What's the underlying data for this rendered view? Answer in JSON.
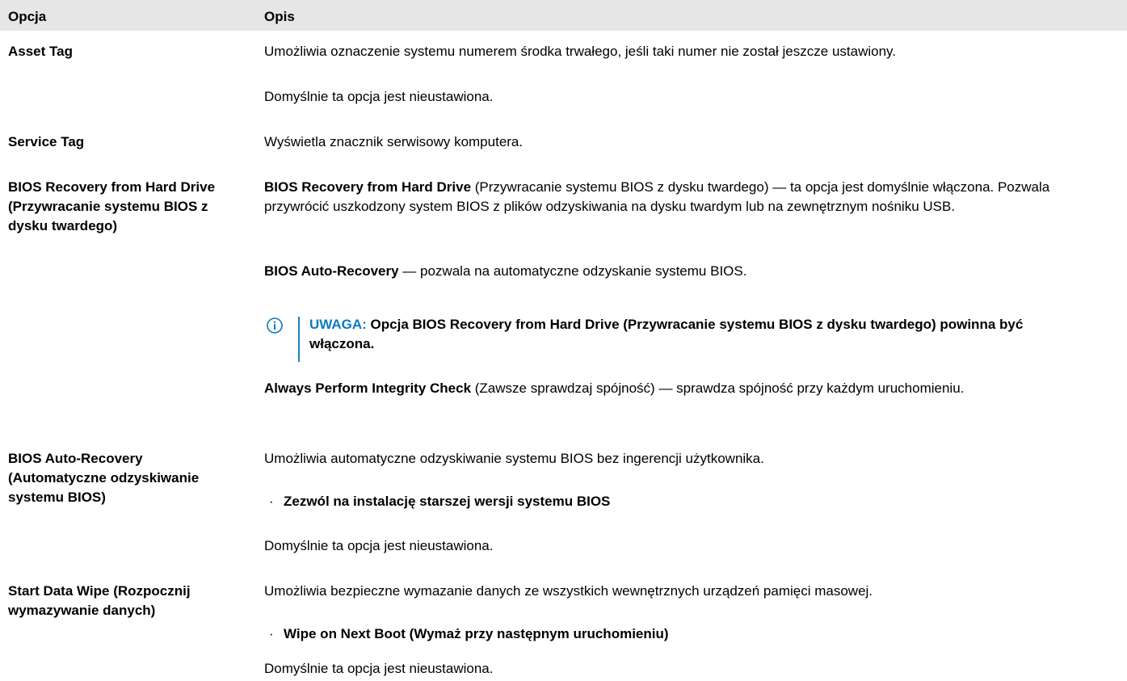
{
  "header": {
    "col1": "Opcja",
    "col2": "Opis"
  },
  "rows": {
    "asset_tag": {
      "option": "Asset Tag",
      "desc1": "Umożliwia oznaczenie systemu numerem środka trwałego, jeśli taki numer nie został jeszcze ustawiony.",
      "desc2": "Domyślnie ta opcja jest nieustawiona."
    },
    "service_tag": {
      "option": "Service Tag",
      "desc1": "Wyświetla znacznik serwisowy komputera."
    },
    "bios_recovery": {
      "option": "BIOS Recovery from Hard Drive (Przywracanie systemu BIOS z dysku twardego)",
      "p1_bold": "BIOS Recovery from Hard Drive",
      "p1_text": " (Przywracanie systemu BIOS z dysku twardego) — ta opcja jest domyślnie włączona. Pozwala przywrócić uszkodzony system BIOS z plików odzyskiwania na dysku twardym lub na zewnętrznym nośniku USB.",
      "p2_bold": "BIOS Auto-Recovery",
      "p2_text": " — pozwala na automatyczne odzyskanie systemu BIOS.",
      "note_label": "UWAGA:",
      "note_text": " Opcja BIOS Recovery from Hard Drive (Przywracanie systemu BIOS z dysku twardego) powinna być włączona.",
      "p3_bold": "Always Perform Integrity Check",
      "p3_text": " (Zawsze sprawdzaj spójność) — sprawdza spójność przy każdym uruchomieniu."
    },
    "bios_auto": {
      "option": "BIOS Auto-Recovery (Automatyczne odzyskiwanie systemu BIOS)",
      "desc1": "Umożliwia automatyczne odzyskiwanie systemu BIOS bez ingerencji użytkownika.",
      "bullet": "Zezwól na instalację starszej wersji systemu BIOS",
      "desc2": "Domyślnie ta opcja jest nieustawiona."
    },
    "data_wipe": {
      "option": "Start Data Wipe (Rozpocznij wymazywanie danych)",
      "desc1": "Umożliwia bezpieczne wymazanie danych ze wszystkich wewnętrznych urządzeń pamięci masowej.",
      "bullet": "Wipe on Next Boot (Wymaż przy następnym uruchomieniu)",
      "desc2": "Domyślnie ta opcja jest nieustawiona."
    }
  },
  "bullet_char": "·",
  "icons": {
    "note": "info-circle-icon"
  },
  "colors": {
    "accent": "#0b7bc4",
    "header_bg": "#e6e6e6"
  }
}
